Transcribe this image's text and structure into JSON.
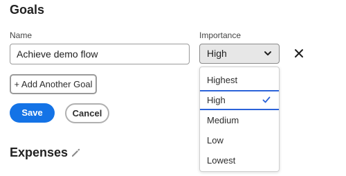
{
  "goals": {
    "title": "Goals",
    "name_label": "Name",
    "name_value": "Achieve demo flow",
    "importance_label": "Importance",
    "importance_selected": "High",
    "importance_options": [
      "Highest",
      "High",
      "Medium",
      "Low",
      "Lowest"
    ],
    "add_goal_label": "+ Add Another Goal",
    "save_label": "Save",
    "cancel_label": "Cancel"
  },
  "expenses": {
    "title": "Expenses"
  },
  "colors": {
    "primary": "#1473e6",
    "selected_border": "#2b63d9"
  },
  "icons": {
    "select_toggle": "chevron-down-icon",
    "remove_goal": "close-icon",
    "option_selected": "checkmark-icon",
    "edit_expenses": "pencil-icon"
  }
}
